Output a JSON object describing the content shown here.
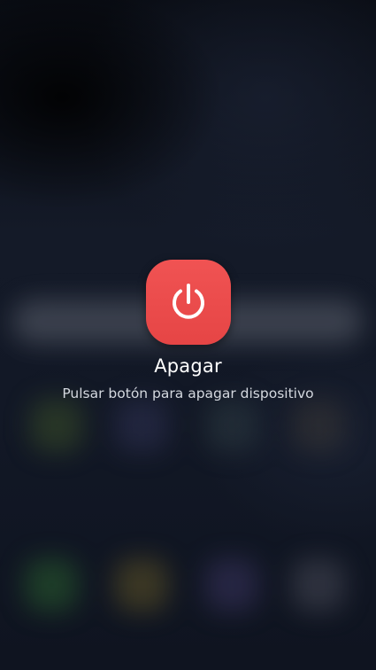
{
  "power_dialog": {
    "icon": "power-icon",
    "title": "Apagar",
    "subtitle": "Pulsar botón para apagar dispositivo",
    "accent_color": "#e84a4a"
  }
}
